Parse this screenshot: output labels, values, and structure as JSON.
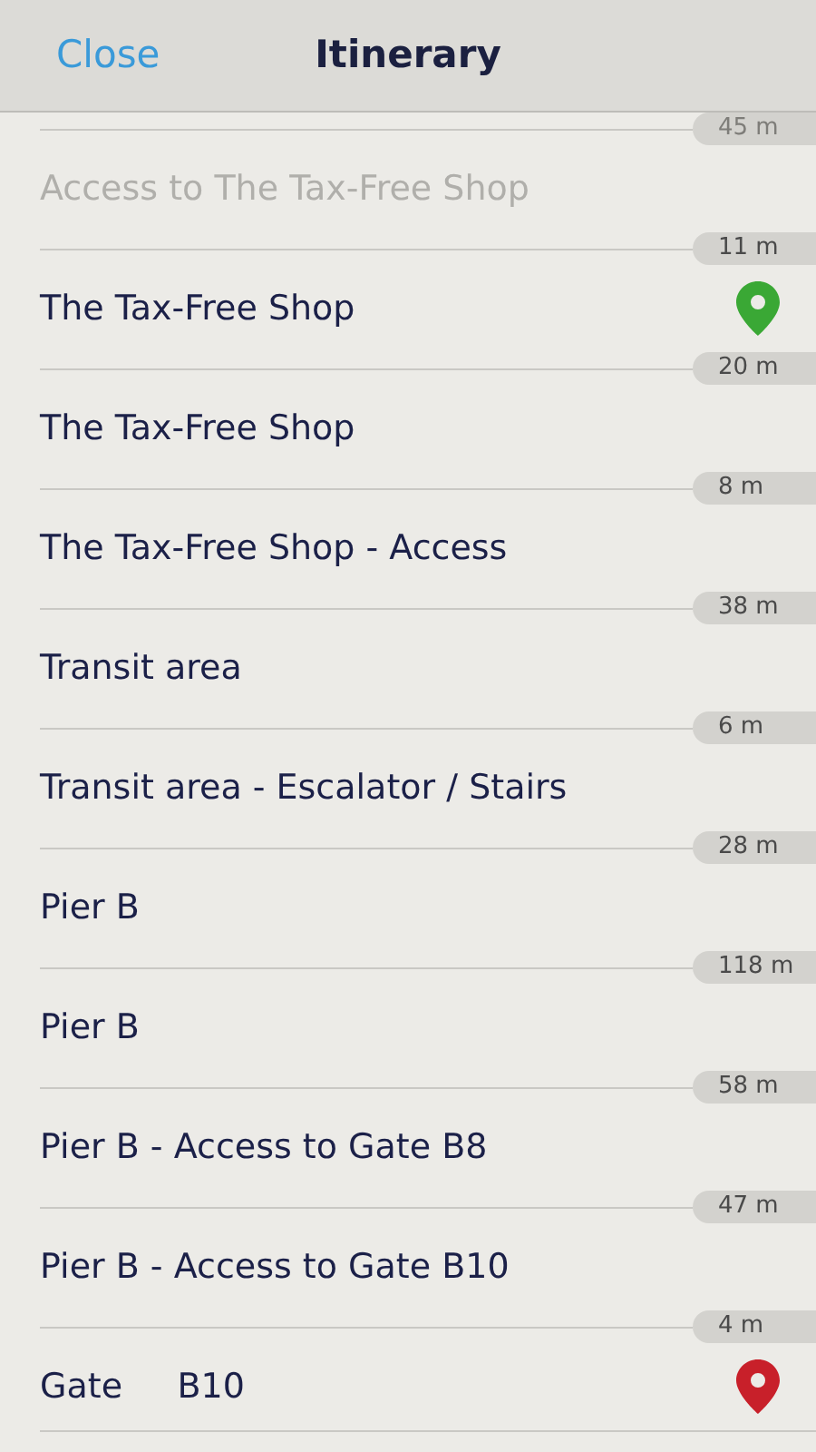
{
  "header": {
    "close": "Close",
    "title": "Itinerary"
  },
  "steps": [
    {
      "distance": "45 m",
      "label": "Access to The Tax-Free Shop",
      "passed": true,
      "kind": "stop"
    },
    {
      "distance": "11 m",
      "label": "The Tax-Free Shop",
      "passed": false,
      "kind": "start"
    },
    {
      "distance": "20 m",
      "label": "The Tax-Free Shop",
      "passed": false,
      "kind": "stop"
    },
    {
      "distance": "8 m",
      "label": "The Tax-Free Shop - Access",
      "passed": false,
      "kind": "stop"
    },
    {
      "distance": "38 m",
      "label": "Transit area",
      "passed": false,
      "kind": "stop"
    },
    {
      "distance": "6 m",
      "label": "Transit area - Escalator / Stairs",
      "passed": false,
      "kind": "stop"
    },
    {
      "distance": "28 m",
      "label": "Pier B",
      "passed": false,
      "kind": "stop"
    },
    {
      "distance": "118 m",
      "label": "Pier B",
      "passed": false,
      "kind": "stop"
    },
    {
      "distance": "58 m",
      "label": "Pier B - Access to Gate B8",
      "passed": false,
      "kind": "stop"
    },
    {
      "distance": "47 m",
      "label": "Pier B - Access to Gate B10",
      "passed": false,
      "kind": "stop"
    },
    {
      "distance": "4 m",
      "label": "Gate     B10",
      "passed": false,
      "kind": "destination"
    }
  ]
}
